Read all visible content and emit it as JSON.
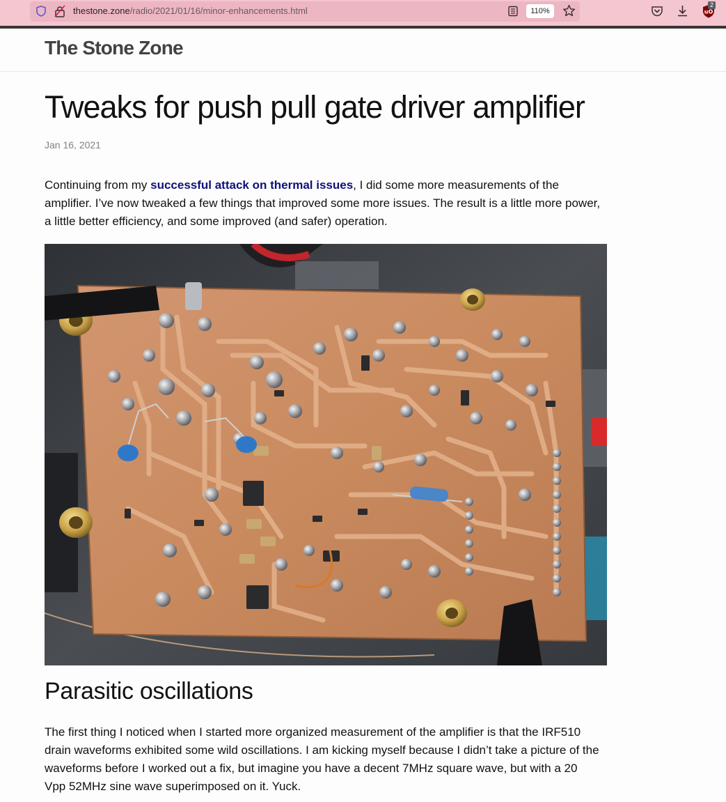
{
  "browser": {
    "url_host": "thestone.zone",
    "url_path": "/radio/2021/01/16/minor-enhancements.html",
    "zoom_level": "110%",
    "extension_badge_count": "2",
    "icons": [
      "shield-icon",
      "lock-icon",
      "reader-view-icon",
      "bookmark-star-icon",
      "pocket-icon",
      "download-icon",
      "ublock-icon"
    ]
  },
  "site": {
    "title": "The Stone Zone"
  },
  "post": {
    "title": "Tweaks for push pull gate driver amplifier",
    "date": "Jan 16, 2021",
    "intro_before_link": "Continuing from my ",
    "intro_link": "successful attack on thermal issues",
    "intro_after_link": ", I did some more measurements of the amplifier. I’ve now tweaked a few things that improved some more issues. The result is a little more power, a little better efficiency, and some improved (and safer) operation.",
    "section_heading": "Parasitic oscillations",
    "section_paragraph": "The first thing I noticed when I started more organized measurement of the amplifier is that the IRF510 drain waveforms exhibited some wild oscillations. I am kicking myself because I didn’t take a picture of the waveforms before I worked out a fix, but imagine you have a decent 7MHz square wave, but with a 20 Vpp 52MHz sine wave superimposed on it. Yuck."
  },
  "colors": {
    "chrome_background": "#f4c6d0",
    "url_box": "#ecb6c2",
    "link": "#10107a",
    "date_text": "#828282",
    "site_title": "#424242",
    "pcb_copper": "#c98a5e"
  }
}
